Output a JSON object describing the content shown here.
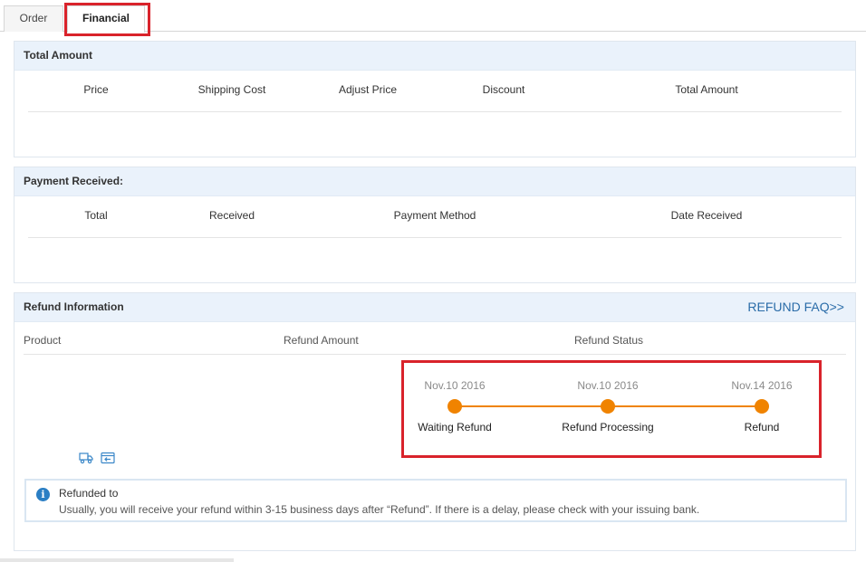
{
  "tabs": [
    {
      "label": "Order",
      "active": false
    },
    {
      "label": "Financial",
      "active": true
    }
  ],
  "total_amount": {
    "title": "Total Amount",
    "columns": [
      "Price",
      "Shipping Cost",
      "Adjust Price",
      "Discount",
      "Total Amount"
    ]
  },
  "payment_received": {
    "title": "Payment Received:",
    "columns": [
      "Total",
      "Received",
      "Payment Method",
      "Date Received"
    ]
  },
  "refund": {
    "title": "Refund Information",
    "faq_link": "REFUND FAQ>>",
    "columns": [
      "Product",
      "Refund Amount",
      "Refund Status"
    ],
    "timeline": [
      {
        "date": "Nov.10 2016",
        "label": "Waiting Refund"
      },
      {
        "date": "Nov.10 2016",
        "label": "Refund Processing"
      },
      {
        "date": "Nov.14 2016",
        "label": "Refund"
      }
    ],
    "icons": [
      "truck-icon",
      "return-icon"
    ],
    "notice": {
      "title": "Refunded to",
      "text": "Usually, you will receive your refund within 3-15 business days after “Refund”. If there is a delay, please check with your issuing bank."
    }
  },
  "colors": {
    "accent_orange": "#f08300",
    "highlight_red": "#d9232b",
    "header_bg": "#eaf2fb",
    "link_blue": "#2a6ca8"
  }
}
